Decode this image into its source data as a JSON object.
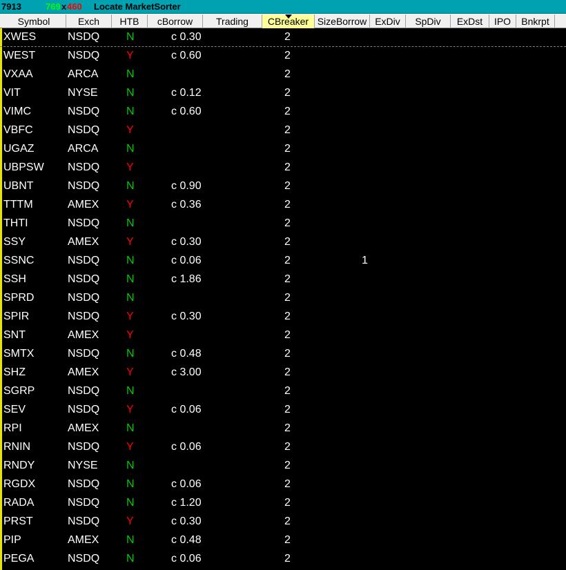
{
  "window": {
    "id": "7913",
    "width_label": "769",
    "times": "x",
    "height_label": "460",
    "title": "Locate MarketSorter"
  },
  "columns": [
    "Symbol",
    "Exch",
    "HTB",
    "cBorrow",
    "Trading",
    "CBreaker",
    "SizeBorrow",
    "ExDiv",
    "SpDiv",
    "ExDst",
    "IPO",
    "Bnkrpt"
  ],
  "sorted_column": "CBreaker",
  "rows": [
    {
      "symbol": "XWES",
      "exch": "NSDQ",
      "htb": "N",
      "cborrow": "c 0.30",
      "cbreaker": "2",
      "sizeborrow": ""
    },
    {
      "symbol": "WEST",
      "exch": "NSDQ",
      "htb": "Y",
      "cborrow": "c 0.60",
      "cbreaker": "2",
      "sizeborrow": ""
    },
    {
      "symbol": "VXAA",
      "exch": "ARCA",
      "htb": "N",
      "cborrow": "",
      "cbreaker": "2",
      "sizeborrow": ""
    },
    {
      "symbol": "VIT",
      "exch": "NYSE",
      "htb": "N",
      "cborrow": "c 0.12",
      "cbreaker": "2",
      "sizeborrow": ""
    },
    {
      "symbol": "VIMC",
      "exch": "NSDQ",
      "htb": "N",
      "cborrow": "c 0.60",
      "cbreaker": "2",
      "sizeborrow": ""
    },
    {
      "symbol": "VBFC",
      "exch": "NSDQ",
      "htb": "Y",
      "cborrow": "",
      "cbreaker": "2",
      "sizeborrow": ""
    },
    {
      "symbol": "UGAZ",
      "exch": "ARCA",
      "htb": "N",
      "cborrow": "",
      "cbreaker": "2",
      "sizeborrow": ""
    },
    {
      "symbol": "UBPSW",
      "exch": "NSDQ",
      "htb": "Y",
      "cborrow": "",
      "cbreaker": "2",
      "sizeborrow": ""
    },
    {
      "symbol": "UBNT",
      "exch": "NSDQ",
      "htb": "N",
      "cborrow": "c 0.90",
      "cbreaker": "2",
      "sizeborrow": ""
    },
    {
      "symbol": "TTTM",
      "exch": "AMEX",
      "htb": "Y",
      "cborrow": "c 0.36",
      "cbreaker": "2",
      "sizeborrow": ""
    },
    {
      "symbol": "THTI",
      "exch": "NSDQ",
      "htb": "N",
      "cborrow": "",
      "cbreaker": "2",
      "sizeborrow": ""
    },
    {
      "symbol": "SSY",
      "exch": "AMEX",
      "htb": "Y",
      "cborrow": "c 0.30",
      "cbreaker": "2",
      "sizeborrow": ""
    },
    {
      "symbol": "SSNC",
      "exch": "NSDQ",
      "htb": "N",
      "cborrow": "c 0.06",
      "cbreaker": "2",
      "sizeborrow": "1"
    },
    {
      "symbol": "SSH",
      "exch": "NSDQ",
      "htb": "N",
      "cborrow": "c 1.86",
      "cbreaker": "2",
      "sizeborrow": ""
    },
    {
      "symbol": "SPRD",
      "exch": "NSDQ",
      "htb": "N",
      "cborrow": "",
      "cbreaker": "2",
      "sizeborrow": ""
    },
    {
      "symbol": "SPIR",
      "exch": "NSDQ",
      "htb": "Y",
      "cborrow": "c 0.30",
      "cbreaker": "2",
      "sizeborrow": ""
    },
    {
      "symbol": "SNT",
      "exch": "AMEX",
      "htb": "Y",
      "cborrow": "",
      "cbreaker": "2",
      "sizeborrow": ""
    },
    {
      "symbol": "SMTX",
      "exch": "NSDQ",
      "htb": "N",
      "cborrow": "c 0.48",
      "cbreaker": "2",
      "sizeborrow": ""
    },
    {
      "symbol": "SHZ",
      "exch": "AMEX",
      "htb": "Y",
      "cborrow": "c 3.00",
      "cbreaker": "2",
      "sizeborrow": ""
    },
    {
      "symbol": "SGRP",
      "exch": "NSDQ",
      "htb": "N",
      "cborrow": "",
      "cbreaker": "2",
      "sizeborrow": ""
    },
    {
      "symbol": "SEV",
      "exch": "NSDQ",
      "htb": "Y",
      "cborrow": "c 0.06",
      "cbreaker": "2",
      "sizeborrow": ""
    },
    {
      "symbol": "RPI",
      "exch": "AMEX",
      "htb": "N",
      "cborrow": "",
      "cbreaker": "2",
      "sizeborrow": ""
    },
    {
      "symbol": "RNIN",
      "exch": "NSDQ",
      "htb": "Y",
      "cborrow": "c 0.06",
      "cbreaker": "2",
      "sizeborrow": ""
    },
    {
      "symbol": "RNDY",
      "exch": "NYSE",
      "htb": "N",
      "cborrow": "",
      "cbreaker": "2",
      "sizeborrow": ""
    },
    {
      "symbol": "RGDX",
      "exch": "NSDQ",
      "htb": "N",
      "cborrow": "c 0.06",
      "cbreaker": "2",
      "sizeborrow": ""
    },
    {
      "symbol": "RADA",
      "exch": "NSDQ",
      "htb": "N",
      "cborrow": "c 1.20",
      "cbreaker": "2",
      "sizeborrow": ""
    },
    {
      "symbol": "PRST",
      "exch": "NSDQ",
      "htb": "Y",
      "cborrow": "c 0.30",
      "cbreaker": "2",
      "sizeborrow": ""
    },
    {
      "symbol": "PIP",
      "exch": "AMEX",
      "htb": "N",
      "cborrow": "c 0.48",
      "cbreaker": "2",
      "sizeborrow": ""
    },
    {
      "symbol": "PEGA",
      "exch": "NSDQ",
      "htb": "N",
      "cborrow": "c 0.06",
      "cbreaker": "2",
      "sizeborrow": ""
    }
  ]
}
